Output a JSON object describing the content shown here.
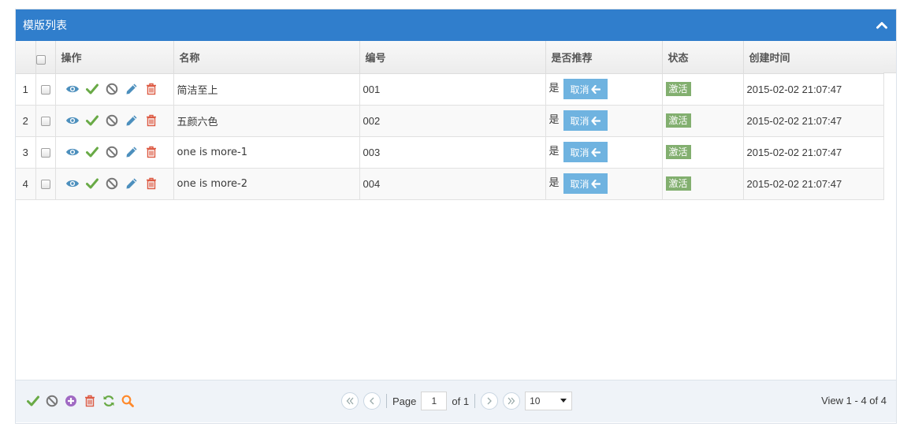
{
  "panel": {
    "title": "模版列表"
  },
  "columns": {
    "actions": "操作",
    "name": "名称",
    "code": "编号",
    "recommend": "是否推荐",
    "status": "状态",
    "created": "创建时间"
  },
  "rows": [
    {
      "num": "1",
      "name": "简洁至上",
      "code": "001",
      "recommend": "是",
      "cancel_label": "取消",
      "status": "激活",
      "created": "2015-02-02 21:07:47"
    },
    {
      "num": "2",
      "name": "五颜六色",
      "code": "002",
      "recommend": "是",
      "cancel_label": "取消",
      "status": "激活",
      "created": "2015-02-02 21:07:47"
    },
    {
      "num": "3",
      "name": "one is more-1",
      "code": "003",
      "recommend": "是",
      "cancel_label": "取消",
      "status": "激活",
      "created": "2015-02-02 21:07:47"
    },
    {
      "num": "4",
      "name": "one is more-2",
      "code": "004",
      "recommend": "是",
      "cancel_label": "取消",
      "status": "激活",
      "created": "2015-02-02 21:07:47"
    }
  ],
  "row_icons": [
    "eye-icon",
    "check-icon",
    "ban-icon",
    "pencil-icon",
    "trash-icon"
  ],
  "pager": {
    "toolbar_icons": [
      "check-icon",
      "ban-icon",
      "plus-circle-icon",
      "trash-icon",
      "refresh-icon",
      "search-icon"
    ],
    "page_label": "Page",
    "page_value": "1",
    "of_label": "of 1",
    "rows_per_page": "10",
    "view_text": "View 1 - 4 of 4"
  },
  "colors": {
    "header_bar": "#307ecc",
    "eye": "#4c8fbd",
    "check": "#69aa46",
    "ban": "#777777",
    "pencil": "#4c8fbd",
    "trash": "#dd5a43",
    "cancel_button": "#6fb3e0",
    "badge_active": "#82af6f",
    "plus": "#a069c3",
    "refresh": "#69aa46",
    "search": "#ff892a"
  }
}
